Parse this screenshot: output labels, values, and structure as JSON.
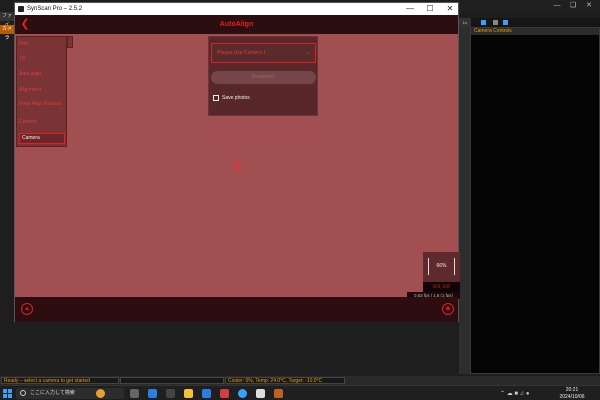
{
  "window": {
    "title": "SynScan Pro – 2.5.2",
    "minimize": "—",
    "maximize": "☐",
    "close": "✕"
  },
  "app": {
    "header_title": "AutoAlign",
    "back_icon": "❮"
  },
  "menu": {
    "items": [
      {
        "label": "Plot"
      },
      {
        "label": "Tilt"
      },
      {
        "label": "Auto align"
      },
      {
        "label": "Alignment"
      },
      {
        "label": "Polar Align Routine"
      },
      {
        "label": "Camera"
      },
      {
        "label": "Camera"
      }
    ]
  },
  "panel": {
    "camera_select": "Please Use Camera 1",
    "properties_label": "Properties",
    "save_photos_label": "Save photos",
    "save_photos_checked": false
  },
  "hud": {
    "zoom": "66%",
    "coords": "0.0, 0.0",
    "fps": "0.63 fps | 1.6 (1 fps)"
  },
  "host": {
    "camera_panel_title": "Camera Controls",
    "left_tab_1": "ファイ",
    "left_tab_2": "カメラ",
    "status_1": "Ready – select a camera to get started",
    "status_2": "Cooler: 0%, Temp: 24.0°C, Target: -10.0°C"
  },
  "taskbar": {
    "search_placeholder": "ここに入力して検索",
    "time": "20:21",
    "date": "2024/10/06"
  },
  "colors": {
    "accent_red": "#e02020",
    "preview_bg": "#a24f51",
    "app_dark": "#2d0e10"
  }
}
